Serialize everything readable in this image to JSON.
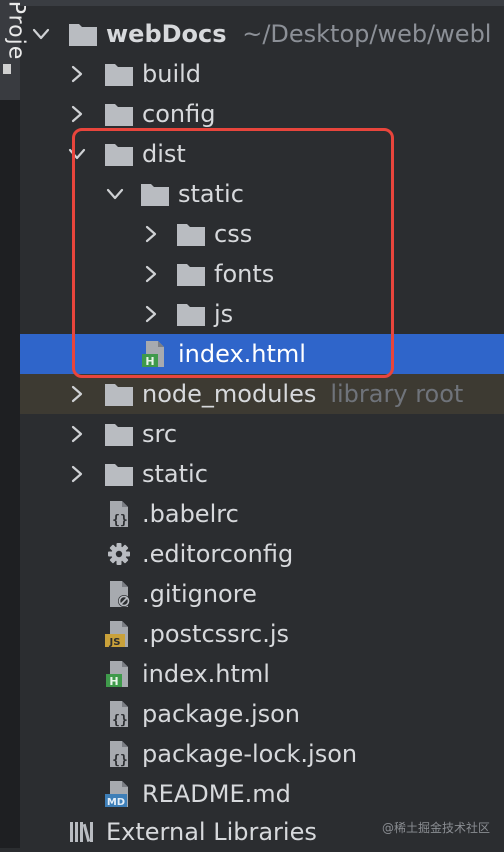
{
  "sidebar": {
    "tab_label": "Proje"
  },
  "tree": {
    "root": {
      "name": "webDocs",
      "path": "~/Desktop/web/webl"
    },
    "items": [
      {
        "label": "build"
      },
      {
        "label": "config"
      },
      {
        "label": "dist"
      },
      {
        "label": "static"
      },
      {
        "label": "css"
      },
      {
        "label": "fonts"
      },
      {
        "label": "js"
      },
      {
        "label": "index.html",
        "selected": true
      },
      {
        "label": "node_modules",
        "hint": "library root"
      },
      {
        "label": "src"
      },
      {
        "label": "static"
      },
      {
        "label": ".babelrc"
      },
      {
        "label": ".editorconfig"
      },
      {
        "label": ".gitignore"
      },
      {
        "label": ".postcssrc.js"
      },
      {
        "label": "index.html"
      },
      {
        "label": "package.json"
      },
      {
        "label": "package-lock.json"
      },
      {
        "label": "README.md"
      },
      {
        "label": "External Libraries"
      }
    ]
  },
  "badges": {
    "html": "H",
    "js": "JS",
    "md": "MD"
  },
  "watermark": "@稀土掘金技术社区",
  "colors": {
    "background": "#2b2d30",
    "selection": "#2f65ca",
    "folder": "#b9bcc1",
    "highlight_border": "#e8453c",
    "html_badge": "#3f9a4b",
    "js_badge": "#c9a13a",
    "md_badge": "#3e7fb8"
  }
}
